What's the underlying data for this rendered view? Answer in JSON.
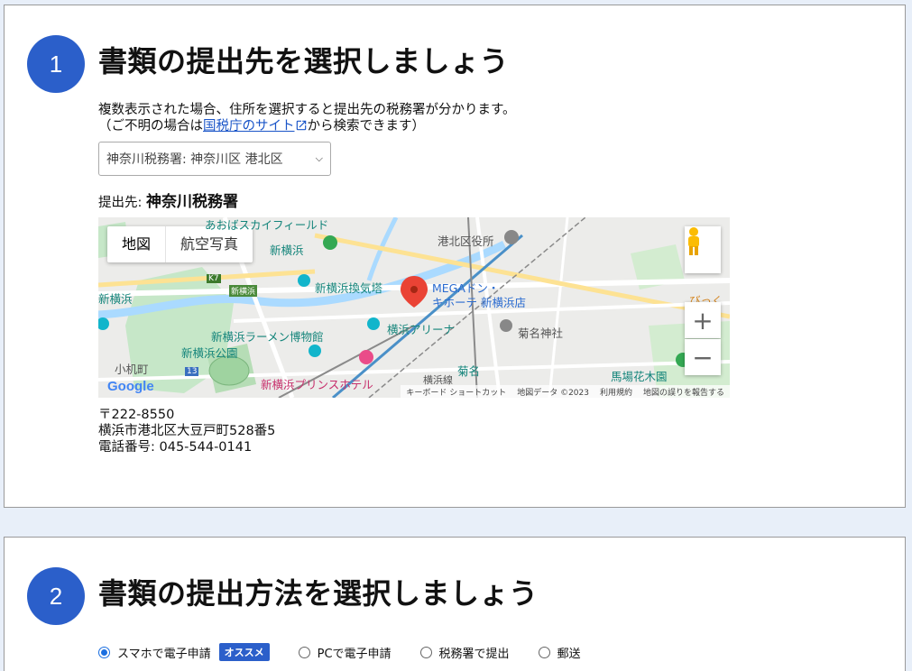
{
  "step1": {
    "number": "1",
    "title": "書類の提出先を選択しましょう",
    "desc_line1": "複数表示された場合、住所を選択すると提出先の税務署が分かります。",
    "desc_prefix": "（ご不明の場合は",
    "desc_link": "国税庁のサイト",
    "desc_suffix": "から検索できます）",
    "select_value": "神奈川税務署: 神奈川区 港北区",
    "dest_label": "提出先:",
    "dest_value": "神奈川税務署",
    "address_postal": "〒222-8550",
    "address_line": "横浜市港北区大豆戸町528番5",
    "address_phone": "電話番号: 045-544-0141"
  },
  "map": {
    "tab_map": "地図",
    "tab_satellite": "航空写真",
    "labels": {
      "skyfield": "あおばスカイフィールド",
      "ward_office": "港北区役所",
      "shinyokohama": "新横浜",
      "ventilation": "新横浜換気塔",
      "mega": "MEGAドン・",
      "kihote": "キホーテ 新横浜店",
      "ramen": "新横浜ラーメン博物館",
      "arena": "横浜アリーナ",
      "park": "新横浜公園",
      "kikuna_shrine": "菊名神社",
      "kozukue": "小机町",
      "prince": "新横浜プリンスホテル",
      "kikuna": "菊名",
      "bajo": "馬場花木園",
      "yokohama_line": "横浜線",
      "bikku": "びっく",
      "shinyokohama_station_left": "新横浜",
      "road_k7": "K7",
      "road_13": "13",
      "shinyokohama_sign": "新横浜"
    },
    "logo": "Google",
    "footer_keyboard": "キーボード ショートカット",
    "footer_data": "地図データ ©2023",
    "footer_terms": "利用規約",
    "footer_report": "地図の誤りを報告する"
  },
  "step2": {
    "number": "2",
    "title": "書類の提出方法を選択しましょう",
    "methods": [
      {
        "label": "スマホで電子申請",
        "checked": true,
        "badge": "オススメ"
      },
      {
        "label": "PCで電子申請",
        "checked": false
      },
      {
        "label": "税務署で提出",
        "checked": false
      },
      {
        "label": "郵送",
        "checked": false
      }
    ]
  },
  "colors": {
    "accent": "#2b5fca",
    "link": "#1a55c8",
    "background": "#e8eff9"
  }
}
